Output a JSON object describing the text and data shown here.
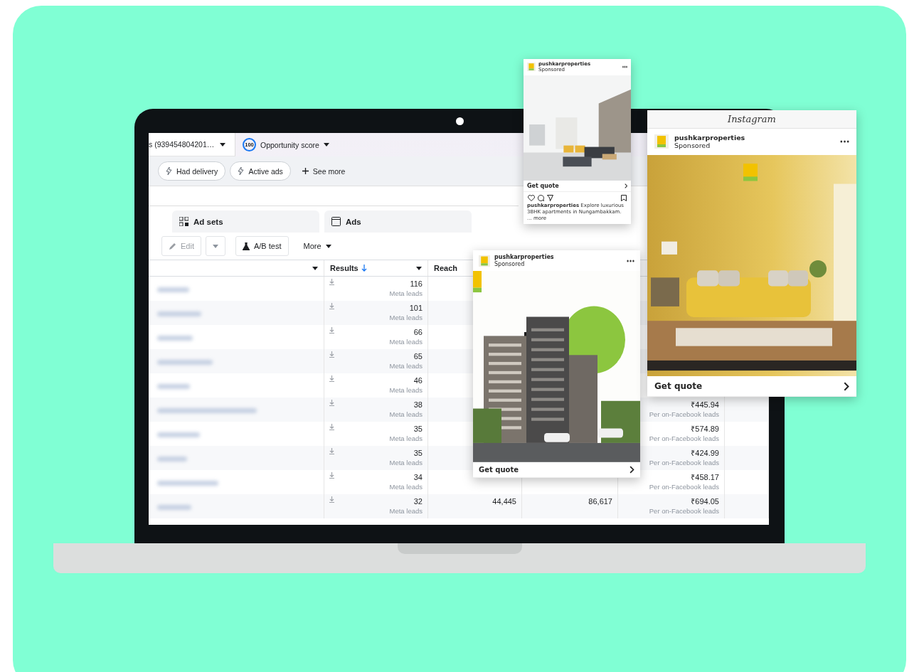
{
  "account_selector": {
    "label": "s (939454804201…"
  },
  "opportunity_score": {
    "score": "100",
    "label": "Opportunity score"
  },
  "filter_chips": [
    {
      "label": "Had delivery"
    },
    {
      "label": "Active ads"
    }
  ],
  "see_more": {
    "label": "See more"
  },
  "tabs": [
    {
      "label": "Ad sets",
      "selected": false
    },
    {
      "label": "Ads",
      "selected": false
    }
  ],
  "toolbar": {
    "edit": {
      "label": "Edit",
      "disabled": true
    },
    "ab_test": {
      "label": "A/B test"
    },
    "more": {
      "label": "More"
    }
  },
  "table": {
    "columns": [
      {
        "label": "Results",
        "sorted": true
      },
      {
        "label": "Reach",
        "sorted": false
      }
    ],
    "rows": [
      {
        "results": "116",
        "results_unit": "Meta leads"
      },
      {
        "results": "101",
        "results_unit": "Meta leads"
      },
      {
        "results": "66",
        "results_unit": "Meta leads"
      },
      {
        "results": "65",
        "results_unit": "Meta leads"
      },
      {
        "results": "46",
        "results_unit": "Meta leads"
      },
      {
        "results": "38",
        "results_unit": "Meta leads",
        "cost": "₹445.94",
        "cost_unit": "Per on-Facebook leads"
      },
      {
        "results": "35",
        "results_unit": "Meta leads",
        "cost": "₹574.89",
        "cost_unit": "Per on-Facebook leads"
      },
      {
        "results": "35",
        "results_unit": "Meta leads",
        "cost": "₹424.99",
        "cost_unit": "Per on-Facebook leads"
      },
      {
        "results": "34",
        "results_unit": "Meta leads",
        "cost": "₹458.17",
        "cost_unit": "Per on-Facebook leads"
      },
      {
        "results": "32",
        "results_unit": "Meta leads",
        "reach": "44,445",
        "column_4": "86,617",
        "cost": "₹694.05",
        "cost_unit": "Per on-Facebook leads"
      }
    ]
  },
  "ad_previews": [
    {
      "kind": "mini",
      "account": "pushkarproperties",
      "sponsored": "Sponsored",
      "cta": "Get quote",
      "caption": "**pushkarproperties** Explore luxurious 3BHK apartments in Nungambakkam. ... more"
    },
    {
      "kind": "feed",
      "account": "pushkarproperties",
      "sponsored": "Sponsored",
      "cta": "Get quote"
    },
    {
      "kind": "large",
      "platform": "Instagram",
      "account": "pushkarproperties",
      "sponsored": "Sponsored",
      "cta": "Get quote"
    }
  ]
}
